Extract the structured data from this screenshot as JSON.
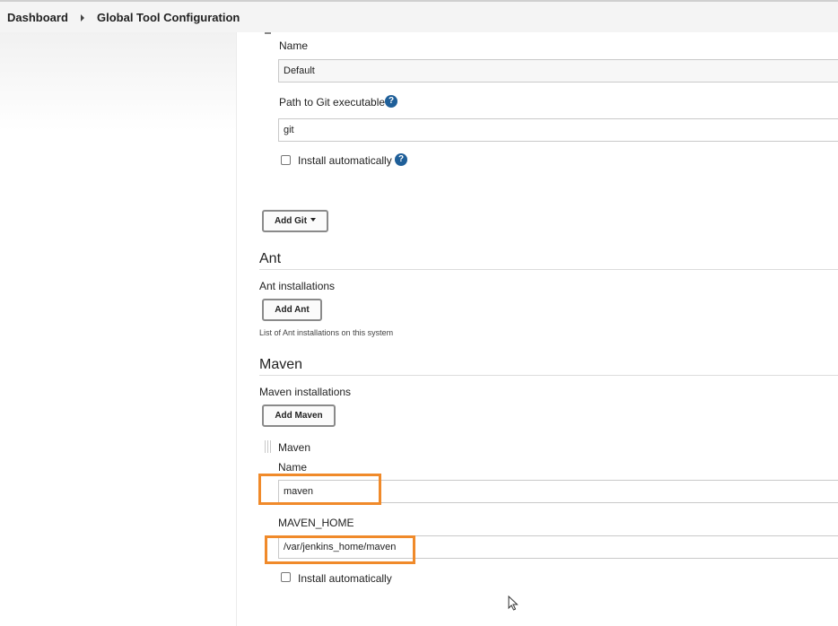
{
  "breadcrumb": {
    "items": [
      "Dashboard",
      "Global Tool Configuration"
    ]
  },
  "git": {
    "name_label": "Name",
    "name_value": "Default",
    "path_label": "Path to Git executable",
    "path_value": "git",
    "install_auto_label": "Install automatically",
    "add_button": "Add Git"
  },
  "ant": {
    "title": "Ant",
    "installations_label": "Ant installations",
    "add_button": "Add Ant",
    "note": "List of Ant installations on this system"
  },
  "maven": {
    "title": "Maven",
    "installations_label": "Maven installations",
    "add_button": "Add Maven",
    "entry_header": "Maven",
    "name_label": "Name",
    "name_value": "maven",
    "home_label": "MAVEN_HOME",
    "home_value": "/var/jenkins_home/maven",
    "install_auto_label": "Install automatically"
  },
  "icons": {
    "help": "?"
  },
  "colors": {
    "highlight": "#f08a2a",
    "help_icon": "#1f5f99"
  }
}
